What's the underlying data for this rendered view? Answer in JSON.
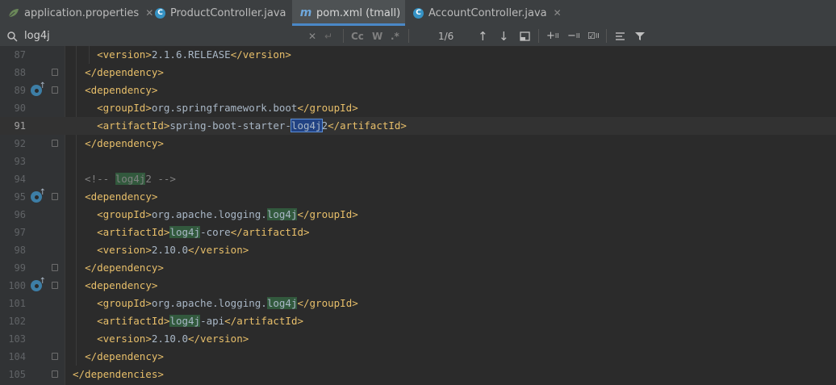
{
  "tabs": [
    {
      "label": "application.properties",
      "icon": "spring-leaf-icon",
      "active": false
    },
    {
      "label": "ProductController.java",
      "icon": "class-icon",
      "active": false
    },
    {
      "label": "pom.xml (tmall)",
      "icon": "maven-icon",
      "active": true
    },
    {
      "label": "AccountController.java",
      "icon": "class-icon",
      "active": false
    }
  ],
  "search": {
    "query": "log4j",
    "match_count": "1/6",
    "match_case_label": "Cc",
    "words_label": "W"
  },
  "lines": [
    {
      "num": "87",
      "text": "    <version>2.1.6.RELEASE</version>"
    },
    {
      "num": "88",
      "text": "  </dependency>"
    },
    {
      "num": "89",
      "text": "  <dependency>"
    },
    {
      "num": "90",
      "text": "    <groupId>org.springframework.boot</groupId>"
    },
    {
      "num": "91",
      "text": "    <artifactId>spring-boot-starter-log4j2</artifactId>"
    },
    {
      "num": "92",
      "text": "  </dependency>"
    },
    {
      "num": "93",
      "text": ""
    },
    {
      "num": "94",
      "text": "  <!-- log4j2 -->"
    },
    {
      "num": "95",
      "text": "  <dependency>"
    },
    {
      "num": "96",
      "text": "    <groupId>org.apache.logging.log4j</groupId>"
    },
    {
      "num": "97",
      "text": "    <artifactId>log4j-core</artifactId>"
    },
    {
      "num": "98",
      "text": "    <version>2.10.0</version>"
    },
    {
      "num": "99",
      "text": "  </dependency>"
    },
    {
      "num": "100",
      "text": "  <dependency>"
    },
    {
      "num": "101",
      "text": "    <groupId>org.apache.logging.log4j</groupId>"
    },
    {
      "num": "102",
      "text": "    <artifactId>log4j-api</artifactId>"
    },
    {
      "num": "103",
      "text": "    <version>2.10.0</version>"
    },
    {
      "num": "104",
      "text": "  </dependency>"
    },
    {
      "num": "105",
      "text": "</dependencies>"
    }
  ],
  "current_line": "91",
  "colors": {
    "tag": "#e8bf6a",
    "text": "#a9b7c6",
    "comment": "#808080",
    "match_highlight": "#32593d",
    "current_match": "#214283",
    "active_tab_underline": "#4a88c7"
  }
}
